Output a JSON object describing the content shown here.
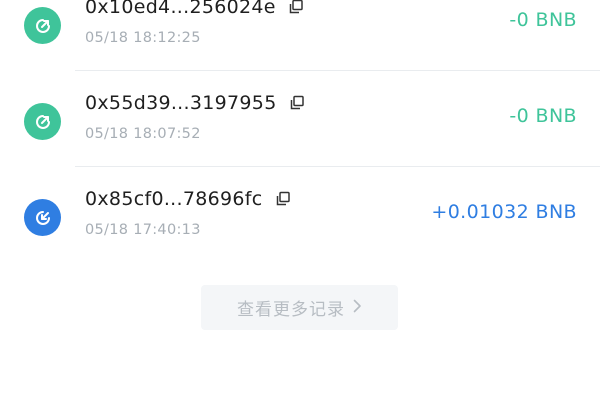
{
  "transactions": [
    {
      "hash": "0x10ed4...256024e",
      "time": "05/18 18:12:25",
      "amount": "-0 BNB",
      "direction": "out",
      "icon": "send-arrow-icon",
      "color": "#3fc49a"
    },
    {
      "hash": "0x55d39...3197955",
      "time": "05/18 18:07:52",
      "amount": "-0 BNB",
      "direction": "out",
      "icon": "send-arrow-icon",
      "color": "#3fc49a"
    },
    {
      "hash": "0x85cf0...78696fc",
      "time": "05/18 17:40:13",
      "amount": "+0.01032 BNB",
      "direction": "in",
      "icon": "receive-arrow-icon",
      "color": "#2f7ee2"
    }
  ],
  "more_button": {
    "label": "查看更多记录",
    "icon": "chevron-right-icon"
  },
  "colors": {
    "outgoing": "#3fc49a",
    "incoming": "#2f7ee2",
    "secondary_text": "#a7aeb5"
  }
}
